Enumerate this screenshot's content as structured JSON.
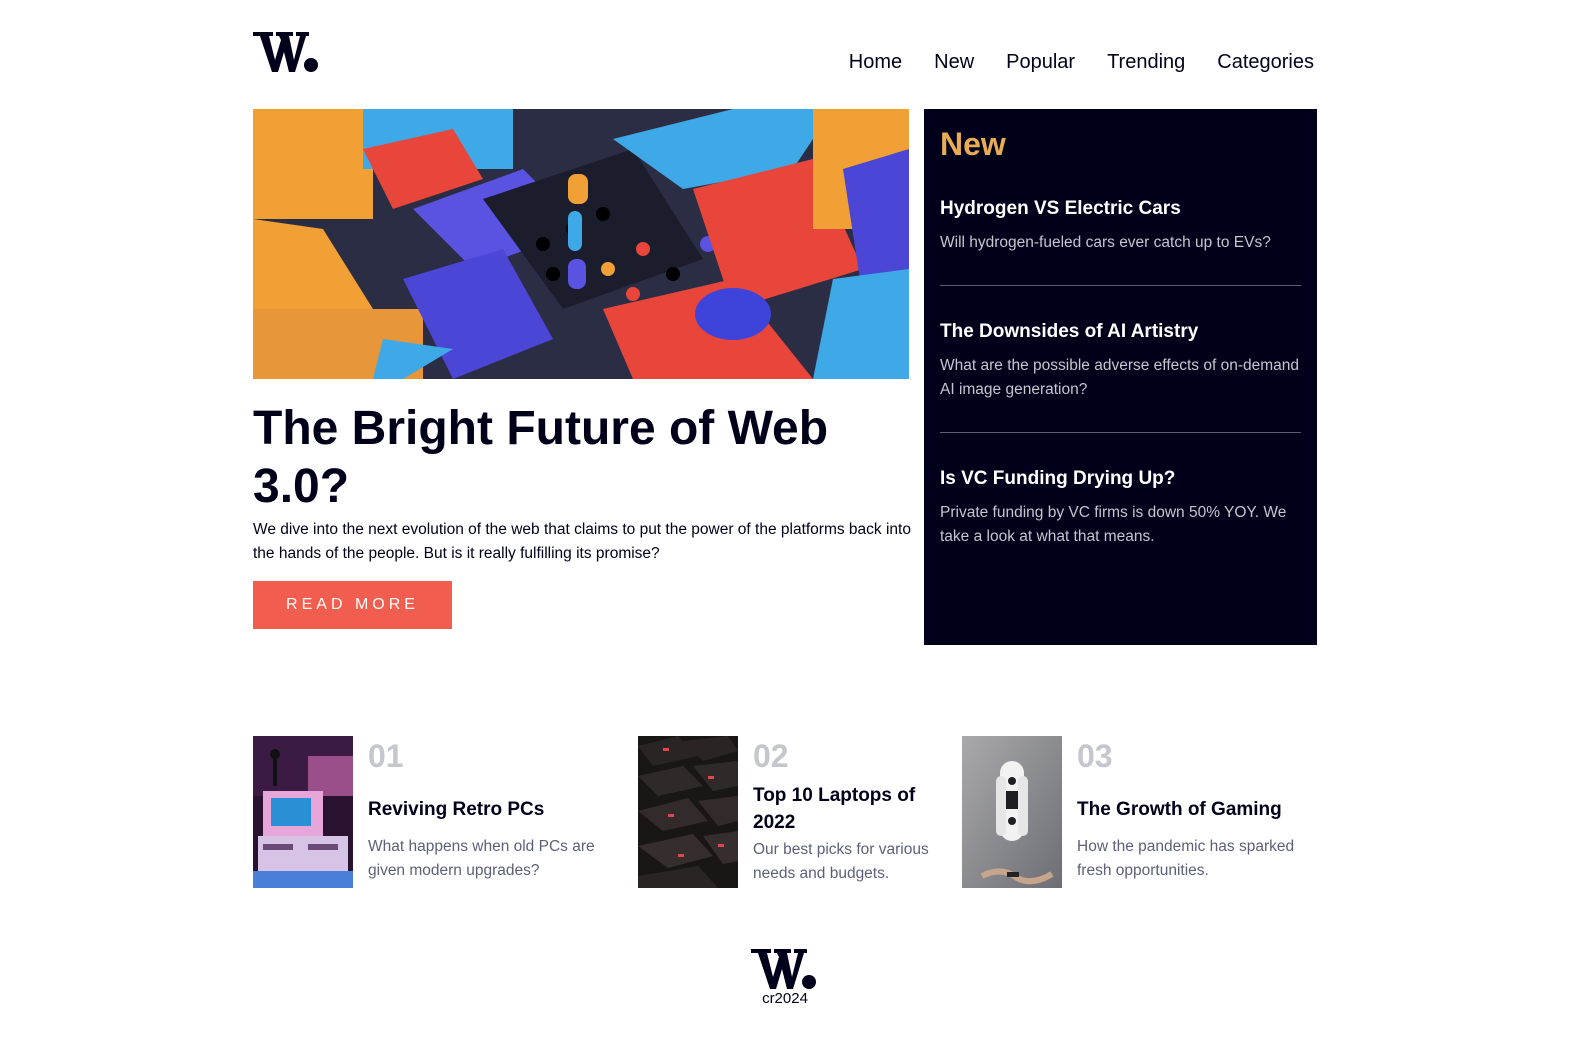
{
  "brand": {
    "logo_icon": "w-dot-logo",
    "accent_color": "#f15e50",
    "dark_color": "#00001a",
    "highlight_color": "#e9ab53"
  },
  "nav": {
    "items": [
      "Home",
      "New",
      "Popular",
      "Trending",
      "Categories"
    ]
  },
  "hero": {
    "title": "The Bright Future of Web 3.0?",
    "description": "We dive into the next evolution of the web that claims to put the power of the platforms back into the hands of the people. But is it really fulfilling its promise?",
    "button_label": "READ MORE",
    "image_icon": "abstract-3d-blocks-image"
  },
  "new_panel": {
    "heading": "New",
    "items": [
      {
        "title": "Hydrogen VS Electric Cars",
        "description": "Will hydrogen-fueled cars ever catch up to EVs?"
      },
      {
        "title": "The Downsides of AI Artistry",
        "description": "What are the possible adverse effects of on-demand AI image generation?"
      },
      {
        "title": "Is VC Funding Drying Up?",
        "description": "Private funding by VC firms is down 50% YOY. We take a look at what that means."
      }
    ]
  },
  "bottom_cards": [
    {
      "number": "01",
      "title": "Reviving Retro PCs",
      "description": "What happens when old PCs are given modern upgrades?",
      "image_icon": "retro-pc-image"
    },
    {
      "number": "02",
      "title": "Top 10 Laptops of 2022",
      "description": "Our best picks for various needs and budgets.",
      "image_icon": "keyboard-image"
    },
    {
      "number": "03",
      "title": "The Growth of Gaming",
      "description": "How the pandemic has sparked fresh opportunities.",
      "image_icon": "game-controller-image"
    }
  ],
  "footer": {
    "copyright": "cr2024"
  }
}
